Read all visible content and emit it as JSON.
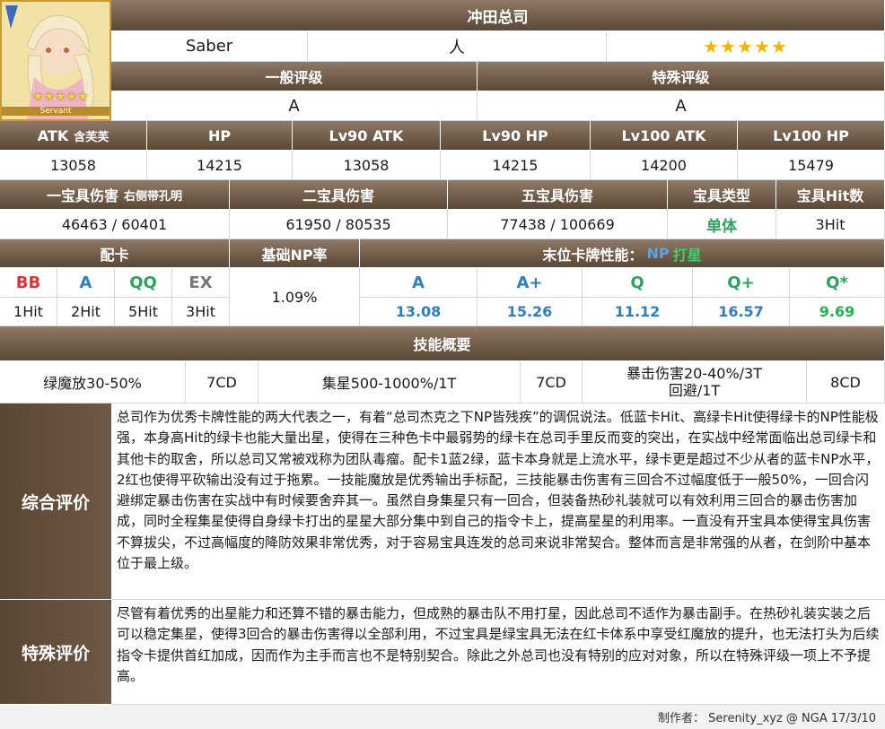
{
  "servant": {
    "name": "冲田总司",
    "class": "Saber",
    "attribute": "人",
    "rarity_stars": "★★★★★",
    "portrait_label": "Servant",
    "portrait_stars": "★★★★★"
  },
  "ratings": {
    "general_label": "一般评级",
    "general_value": "A",
    "special_label": "特殊评级",
    "special_value": "A"
  },
  "stats": {
    "headers": [
      "ATK",
      "HP",
      "Lv90 ATK",
      "Lv90 HP",
      "Lv100 ATK",
      "Lv100 HP"
    ],
    "atk_note": "含芙芙",
    "values": [
      "13058",
      "14215",
      "13058",
      "14215",
      "14200",
      "15479"
    ]
  },
  "np": {
    "h1": "一宝具伤害",
    "h1_note": "右侧带孔明",
    "h2": "二宝具伤害",
    "h3": "五宝具伤害",
    "h4": "宝具类型",
    "h5": "宝具Hit数",
    "v1": "46463 / 60401",
    "v2": "61950 / 80535",
    "v3": "77438 / 100669",
    "v4": "单体",
    "v5": "3Hit"
  },
  "cards": {
    "deck_label": "配卡",
    "base_np_label": "基础NP率",
    "base_np_value": "1.09%",
    "tail_label": "末位卡牌性能：",
    "tail_np": "NP",
    "tail_star": "打星",
    "deck": [
      {
        "card": "BB",
        "hit": "1Hit",
        "color": "#e0323a"
      },
      {
        "card": "A",
        "hit": "2Hit",
        "color": "#2f7ec0"
      },
      {
        "card": "QQ",
        "hit": "5Hit",
        "color": "#2aa35c"
      },
      {
        "card": "EX",
        "hit": "3Hit",
        "color": "#777777"
      }
    ],
    "perf": [
      {
        "card": "A",
        "val": "13.08"
      },
      {
        "card": "A+",
        "val": "15.26"
      },
      {
        "card": "Q",
        "val": "11.12"
      },
      {
        "card": "Q+",
        "val": "16.57"
      },
      {
        "card": "Q*",
        "val": "9.69"
      }
    ]
  },
  "skills": {
    "title": "技能概要",
    "s1": "绿魔放30-50%",
    "s1_cd": "7CD",
    "s2": "集星500-1000%/1T",
    "s2_cd": "7CD",
    "s3_line1": "暴击伤害20-40%/3T",
    "s3_line2": "回避/1T",
    "s3_cd": "8CD"
  },
  "review": {
    "overall_label": "综合评价",
    "overall_text": "总司作为优秀卡牌性能的两大代表之一，有着“总司杰克之下NP皆残疾”的调侃说法。低蓝卡Hit、高绿卡Hit使得绿卡的NP性能极强，本身高Hit的绿卡也能大量出星，使得在三种色卡中最弱势的绿卡在总司手里反而变的突出，在实战中经常面临出总司绿卡和其他卡的取舍，所以总司又常被戏称为团队毒瘤。配卡1蓝2绿，蓝卡本身就是上流水平，绿卡更是超过不少从者的蓝卡NP水平，2红也使得平砍输出没有过于拖累。一技能魔放是优秀输出手标配，三技能暴击伤害有三回合不过幅度低于一般50%，一回合闪避绑定暴击伤害在实战中有时候要舍弃其一。虽然自身集星只有一回合，但装备热砂礼装就可以有效利用三回合的暴击伤害加成，同时全程集星使得自身绿卡打出的星星大部分集中到自己的指令卡上，提高星星的利用率。一直没有开宝具本使得宝具伤害不算拔尖，不过高幅度的降防效果非常优秀，对于容易宝具连发的总司来说非常契合。整体而言是非常强的从者，在剑阶中基本位于最上级。",
    "special_label": "特殊评价",
    "special_text": "尽管有着优秀的出星能力和还算不错的暴击能力，但成熟的暴击队不用打星，因此总司不适作为暴击副手。在热砂礼装实装之后可以稳定集星，使得3回合的暴击伤害得以全部利用，不过宝具是绿宝具无法在红卡体系中享受红魔放的提升，也无法打头为后续指令卡提供首红加成，因而作为主手而言也不是特别契合。除此之外总司也没有特别的应对对象，所以在特殊评级一项上不予提高。"
  },
  "footer": {
    "credit": "制作者： Serenity_xyz @ NGA  17/3/10"
  },
  "colors": {
    "header_brown": "#74604d",
    "side_brown": "#5a4634",
    "buster": "#e0323a",
    "arts": "#2f7ec0",
    "quick": "#2aa35c",
    "star_gold": "#f2b600"
  }
}
